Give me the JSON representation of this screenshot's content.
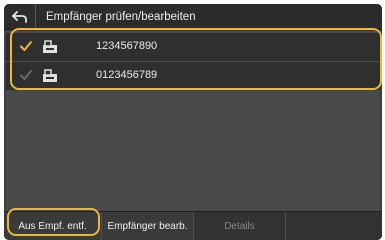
{
  "header": {
    "title": "Empfänger prüfen/bearbeiten",
    "back_icon": "back-arrow-icon"
  },
  "recipients": [
    {
      "number": "1234567890",
      "checked": true,
      "icon": "fax-icon"
    },
    {
      "number": "0123456789",
      "checked": false,
      "icon": "fax-icon"
    }
  ],
  "bottom": {
    "remove_label": "Aus Empf. entf.",
    "edit_label": "Empfänger bearb.",
    "details_label": "Details"
  },
  "colors": {
    "highlight": "#e8b73b",
    "check_active": "#e8b73b",
    "check_inactive": "#6a6a6a"
  }
}
